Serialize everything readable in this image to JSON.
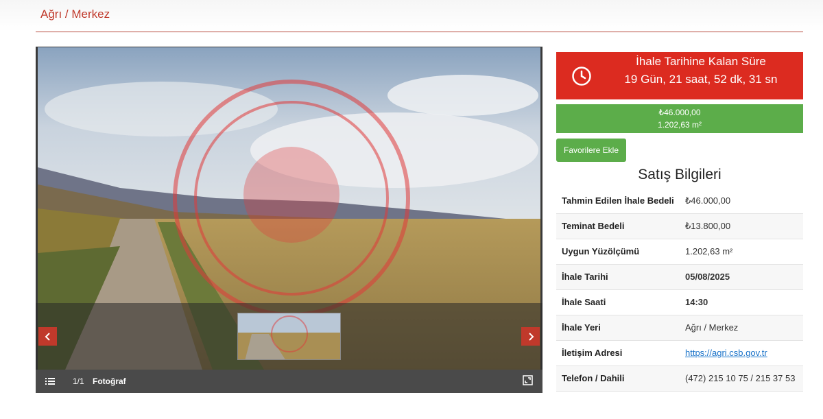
{
  "breadcrumb": "Ağrı / Merkez",
  "gallery": {
    "counter": "1/1",
    "label": "Fotoğraf",
    "icons": {
      "list": "list-icon",
      "fullscreen": "fullscreen-icon",
      "prev": "chevron-left-icon",
      "next": "chevron-right-icon"
    }
  },
  "countdown": {
    "title": "İhale Tarihine Kalan Süre",
    "value": "19 Gün, 21 saat, 52 dk, 31 sn",
    "icon": "clock-icon"
  },
  "price": {
    "amount": "₺46.000,00",
    "area": "1.202,63 m²"
  },
  "favorite_button": "Favorilere Ekle",
  "sales_info": {
    "title": "Satış Bilgileri",
    "rows": [
      {
        "label": "Tahmin Edilen İhale Bedeli",
        "value": "₺46.000,00"
      },
      {
        "label": "Teminat Bedeli",
        "value": "₺13.800,00"
      },
      {
        "label": "Uygun Yüzölçümü",
        "value": "1.202,63 m²"
      },
      {
        "label": "İhale Tarihi",
        "value": "05/08/2025"
      },
      {
        "label": "İhale Saati",
        "value": "14:30"
      },
      {
        "label": "İhale Yeri",
        "value": "Ağrı / Merkez"
      },
      {
        "label": "İletişim Adresi",
        "value": "https://agri.csb.gov.tr"
      },
      {
        "label": "Telefon / Dahili",
        "value": "(472) 215 10 75 / 215 37 53"
      }
    ]
  },
  "colors": {
    "accent_red": "#dc2b20",
    "green": "#5cad4a",
    "breadcrumb": "#c0392b",
    "link": "#1a73c9"
  }
}
